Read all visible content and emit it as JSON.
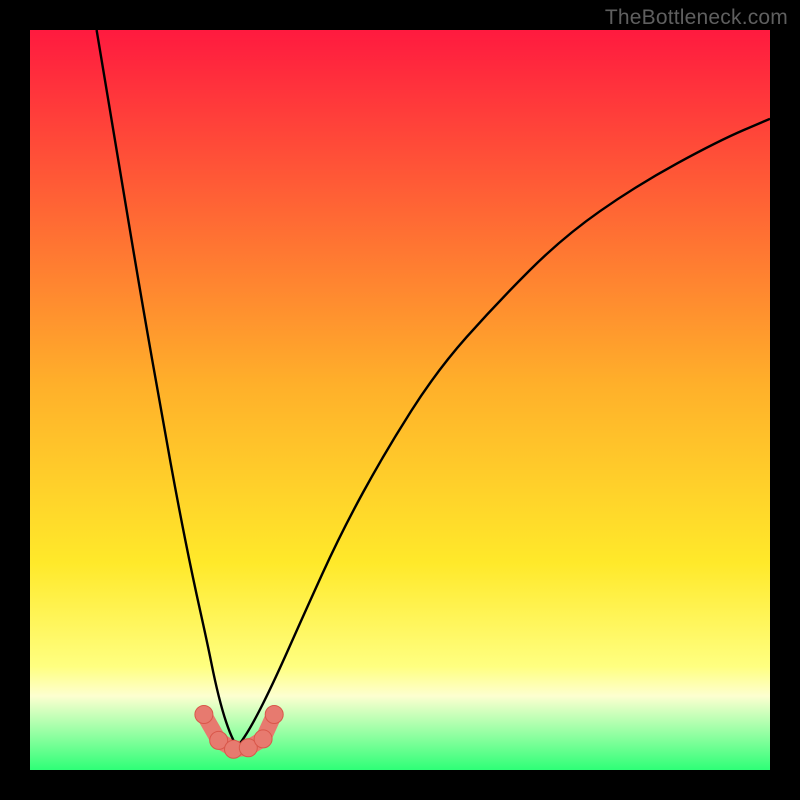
{
  "watermark": "TheBottleneck.com",
  "colors": {
    "frame": "#000000",
    "grad_top": "#ff1a3f",
    "grad_mid": "#ffcf2a",
    "grad_low": "#ffff80",
    "grad_band_top": "#fdffd0",
    "grad_band_bottom": "#2eff77",
    "curve": "#000000",
    "marker_fill": "#e77a6f",
    "marker_stroke": "#d9574a"
  },
  "chart_data": {
    "type": "line",
    "title": "",
    "xlabel": "",
    "ylabel": "",
    "xlim": [
      0,
      100
    ],
    "ylim": [
      0,
      100
    ],
    "vertex_x": 28,
    "series": [
      {
        "name": "left-branch",
        "x": [
          9,
          12,
          15,
          18,
          20,
          22,
          24,
          25,
          26,
          27,
          28
        ],
        "y": [
          100,
          82,
          64,
          47,
          36,
          26,
          17,
          12,
          8,
          5,
          3
        ]
      },
      {
        "name": "right-branch",
        "x": [
          28,
          30,
          33,
          37,
          42,
          48,
          55,
          63,
          72,
          82,
          93,
          100
        ],
        "y": [
          3,
          6,
          12,
          21,
          32,
          43,
          54,
          63,
          72,
          79,
          85,
          88
        ]
      }
    ],
    "markers": {
      "name": "bottom-cluster",
      "x": [
        23.5,
        25.5,
        27.5,
        29.5,
        31.5,
        33.0
      ],
      "y": [
        7.5,
        4.0,
        2.8,
        3.0,
        4.2,
        7.5
      ]
    },
    "marker_connector": {
      "x": [
        23.5,
        25.5,
        27.5,
        29.5,
        31.5,
        33.0
      ],
      "y": [
        7.5,
        4.0,
        2.8,
        3.0,
        4.2,
        7.5
      ]
    }
  }
}
